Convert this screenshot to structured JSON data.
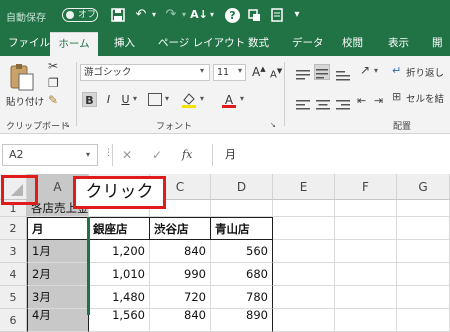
{
  "titlebar": {
    "autosave_label": "自動保存",
    "autosave_state": "オフ"
  },
  "tabs": [
    "ファイル",
    "ホーム",
    "挿入",
    "ページ レイアウト",
    "数式",
    "データ",
    "校閲",
    "表示",
    "開発"
  ],
  "ribbon": {
    "paste_label": "貼り付け",
    "clipboard_group": "クリップボード",
    "font_name": "游ゴシック",
    "font_size": "11",
    "font_group": "フォント",
    "bold": "B",
    "italic": "I",
    "underline": "U",
    "grow_font": "A",
    "shrink_font": "A",
    "font_color_glyph": "A",
    "wrap_text": "折り返し",
    "merge_cells": "セルを結",
    "alignment_group": "配置"
  },
  "formula_bar": {
    "name_box": "A2",
    "fx": "fx",
    "content": "月"
  },
  "sheet": {
    "columns": [
      "A",
      "B",
      "C",
      "D",
      "E",
      "F",
      "G"
    ],
    "row_numbers": [
      "1",
      "2",
      "3",
      "4",
      "5",
      "6"
    ],
    "title_cell": "各店売上金",
    "headers": [
      "月",
      "銀座店",
      "渋谷店",
      "青山店"
    ],
    "rows": [
      [
        "1月",
        "1,200",
        "840",
        "560"
      ],
      [
        "2月",
        "1,010",
        "990",
        "680"
      ],
      [
        "3月",
        "1,480",
        "720",
        "780"
      ],
      [
        "4月",
        "1,560",
        "840",
        "890"
      ]
    ]
  },
  "callout_text": "クリック"
}
